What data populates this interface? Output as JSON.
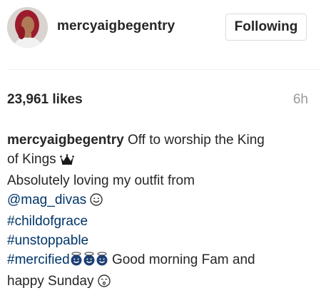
{
  "post": {
    "header": {
      "username": "mercyaigbegentry",
      "follow_button_label": "Following"
    },
    "stats": {
      "likes": "23,961 likes",
      "time_ago": "6h"
    },
    "caption": {
      "author": "mercyaigbegentry",
      "line1_text": "Off to worship the King",
      "line2_text": "of Kings",
      "line3_text": "Absolutely loving my outfit from",
      "mention": "@mag_divas",
      "hashtags": [
        "#childofgrace",
        "#unstoppable",
        "#mercified"
      ],
      "line7_text": "Good morning Fam and",
      "line8_text": "happy Sunday",
      "icons": {
        "crown": "crown-icon",
        "smile": "smiling-face-icon",
        "angel": "smiling-face-with-halo-icon",
        "kiss": "kissing-face-icon"
      }
    },
    "colors": {
      "text": "#262626",
      "link": "#003569",
      "muted": "#999999",
      "border": "#dbdbdb"
    }
  }
}
